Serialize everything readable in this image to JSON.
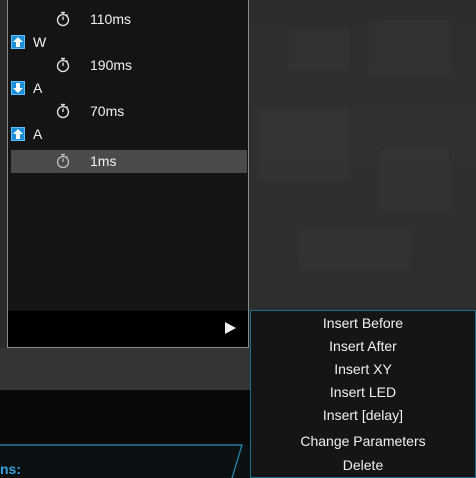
{
  "macro_list": {
    "rows": [
      {
        "type": "delay",
        "value": "110ms"
      },
      {
        "type": "key",
        "direction": "up",
        "key": "W"
      },
      {
        "type": "delay",
        "value": "190ms"
      },
      {
        "type": "key",
        "direction": "down",
        "key": "A"
      },
      {
        "type": "delay",
        "value": "70ms"
      },
      {
        "type": "key",
        "direction": "up",
        "key": "A"
      },
      {
        "type": "delay",
        "value": "1ms",
        "selected": true
      }
    ]
  },
  "section": {
    "label": "ns:"
  },
  "context_menu": {
    "items": [
      "Insert Before",
      "Insert After",
      "Insert XY",
      "Insert LED",
      "Insert [delay]",
      "Change Parameters",
      "Delete"
    ]
  },
  "colors": {
    "key_icon": "#1d8fd6",
    "accent_border": "#1d6f8a",
    "section_label": "#3a9fd9",
    "selected_row": "#4a4a4a"
  }
}
